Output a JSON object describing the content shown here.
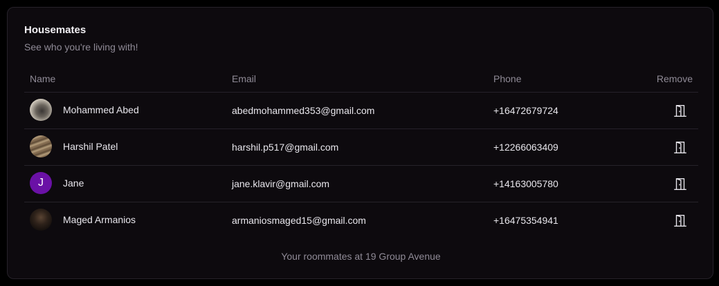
{
  "card": {
    "title": "Housemates",
    "subtitle": "See who you're living with!",
    "caption": "Your roommates at 19 Group Avenue"
  },
  "table": {
    "headers": {
      "name": "Name",
      "email": "Email",
      "phone": "Phone",
      "remove": "Remove"
    },
    "rows": [
      {
        "name": "Mohammed Abed",
        "email": "abedmohammed353@gmail.com",
        "phone": "+16472679724",
        "avatar": "photo",
        "avatar_letter": "",
        "remove_icon": "door-exit-icon"
      },
      {
        "name": "Harshil Patel",
        "email": "harshil.p517@gmail.com",
        "phone": "+12266063409",
        "avatar": "photo",
        "avatar_letter": "",
        "remove_icon": "door-exit-icon"
      },
      {
        "name": "Jane",
        "email": "jane.klavir@gmail.com",
        "phone": "+14163005780",
        "avatar": "letter",
        "avatar_letter": "J",
        "remove_icon": "door-exit-icon"
      },
      {
        "name": "Maged Armanios",
        "email": "armaniosmaged15@gmail.com",
        "phone": "+16475354941",
        "avatar": "photo",
        "avatar_letter": "",
        "remove_icon": "door-exit-icon"
      }
    ]
  },
  "colors": {
    "background": "#000000",
    "card": "#0d0a0e",
    "border": "#26222a",
    "text": "#e8e6ec",
    "muted": "#8f8a96",
    "avatar_letter_bg": "#6a11a6"
  }
}
